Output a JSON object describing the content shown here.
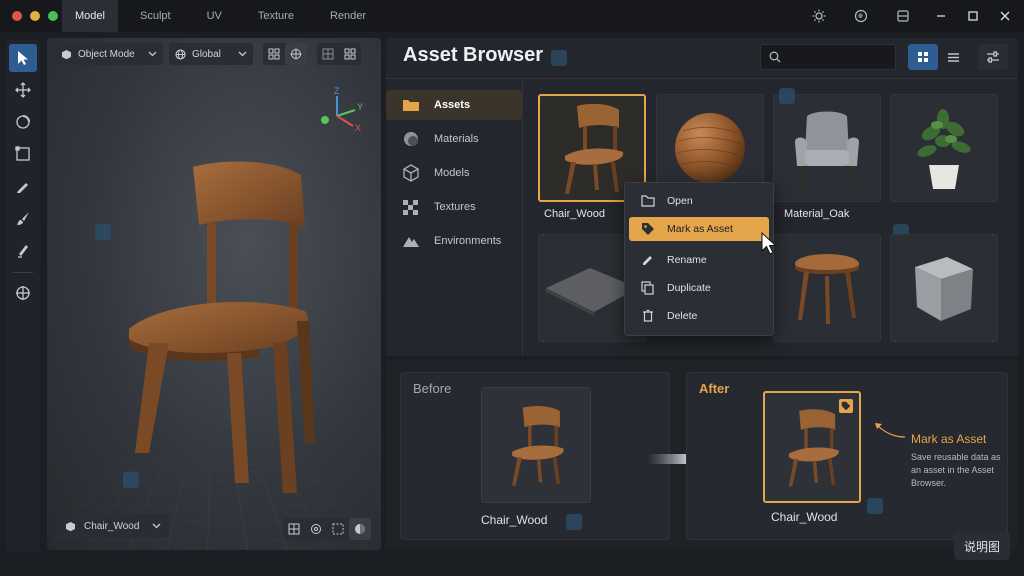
{
  "window": {
    "tabs": [
      "Model",
      "Sculpt",
      "UV",
      "Texture",
      "Render"
    ],
    "active_tab": "Model",
    "traffic_lights": [
      "#e5534b",
      "#e0b23a",
      "#44c25a"
    ],
    "right_icons": [
      "sun-icon",
      "globe-icon",
      "panel-icon",
      "minimize-icon",
      "maximize-icon",
      "close-icon"
    ]
  },
  "left_tools": [
    "select-tool",
    "move-tool",
    "rotate-tool",
    "scale-tool",
    "draw-tool",
    "brush-tool",
    "pen-tool",
    "transform-tool"
  ],
  "viewport": {
    "mode_label": "Object Mode",
    "orientation_label": "Global",
    "axis_labels": {
      "z": "Z",
      "y": "Y",
      "x": "X"
    },
    "object_label": "Chair_Wood"
  },
  "browser": {
    "title": "Asset Browser",
    "search_placeholder": "",
    "categories": [
      {
        "label": "Assets",
        "icon": "folder-icon",
        "active": true
      },
      {
        "label": "Materials",
        "icon": "sphere-icon"
      },
      {
        "label": "Models",
        "icon": "cube-icon"
      },
      {
        "label": "Textures",
        "icon": "checker-icon"
      },
      {
        "label": "Environments",
        "icon": "mountain-icon"
      }
    ],
    "items": [
      {
        "label": "Chair_Wood",
        "icon": "chair-icon"
      },
      {
        "label": "",
        "icon": "wood-sphere-icon"
      },
      {
        "label": "Material_Oak",
        "icon": "armchair-icon"
      },
      {
        "label": "",
        "icon": "plant-icon"
      },
      {
        "label": "",
        "icon": "carpet-icon"
      },
      {
        "label": "",
        "icon": "empty"
      },
      {
        "label": "",
        "icon": "stool-icon"
      },
      {
        "label": "",
        "icon": "stone-cube-icon"
      }
    ]
  },
  "context_menu": {
    "items": [
      {
        "label": "Open",
        "icon": "folder-open-icon"
      },
      {
        "label": "Mark as Asset",
        "icon": "tag-icon",
        "highlighted": true
      },
      {
        "label": "Rename",
        "icon": "pencil-icon"
      },
      {
        "label": "Duplicate",
        "icon": "duplicate-icon"
      },
      {
        "label": "Delete",
        "icon": "trash-icon"
      }
    ]
  },
  "comparison": {
    "before_label": "Before",
    "before_caption": "Chair_Wood",
    "after_label": "After",
    "after_caption": "Chair_Wood",
    "note_title": "Mark as Asset",
    "note_desc": "Save reusable data as an asset in the Asset Browser."
  },
  "legend_button": "说明图",
  "colors": {
    "accent": "#e5a54b",
    "active_blue": "#2f5c93"
  }
}
